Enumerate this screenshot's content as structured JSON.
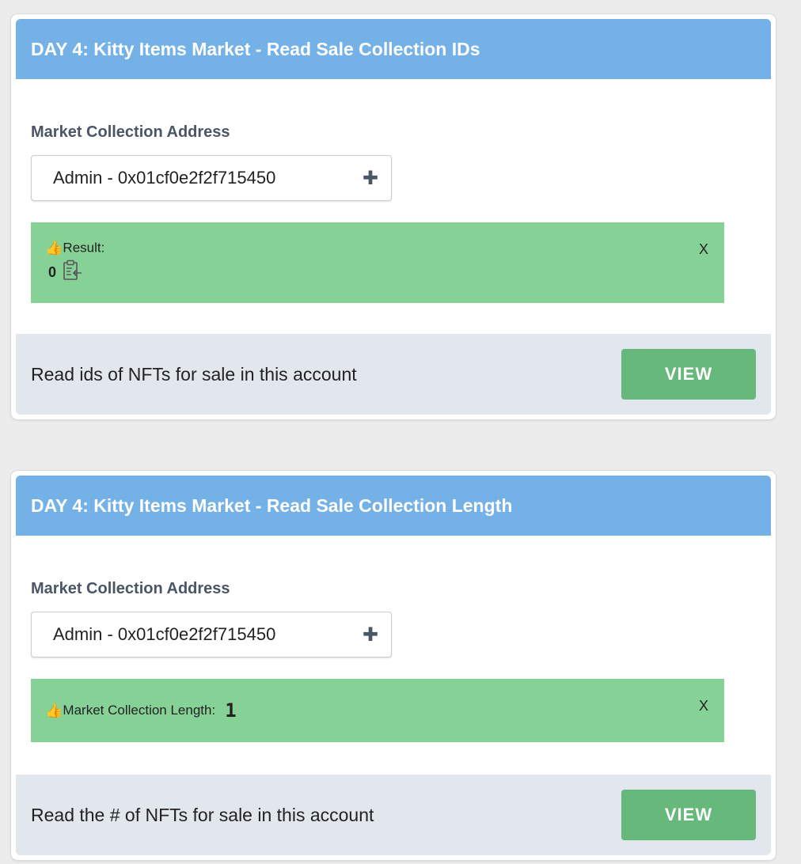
{
  "cards": [
    {
      "title": "DAY 4: Kitty Items Market - Read Sale Collection IDs",
      "field_label": "Market Collection Address",
      "select_value": "Admin - 0x01cf0e2f2f715450",
      "result_label": "Result:",
      "result_value": "0",
      "close_label": "X",
      "footer_text": "Read ids of NFTs for sale in this account",
      "button_label": "VIEW"
    },
    {
      "title": "DAY 4: Kitty Items Market - Read Sale Collection Length",
      "field_label": "Market Collection Address",
      "select_value": "Admin - 0x01cf0e2f2f715450",
      "result_label": "Market Collection Length:",
      "result_value": "1",
      "close_label": "X",
      "footer_text": "Read the # of NFTs for sale in this account",
      "button_label": "VIEW"
    }
  ],
  "icons": {
    "thumbs_up": "thumbs-up-icon",
    "clipboard": "clipboard-icon",
    "plus": "plus-icon"
  },
  "colors": {
    "header": "#74b1e6",
    "result_bg": "#86d196",
    "footer_bg": "#e2e6ed",
    "button": "#67b87b"
  }
}
